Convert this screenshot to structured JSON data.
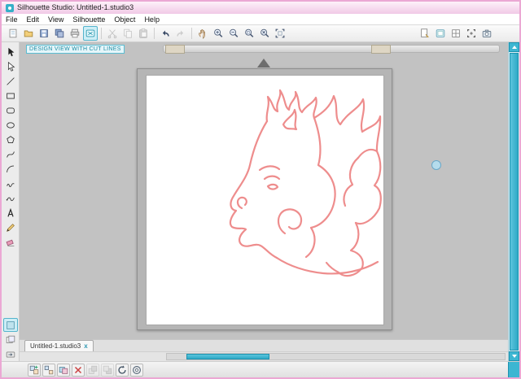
{
  "window": {
    "title": "Silhouette Studio: Untitled-1.studio3"
  },
  "menu": {
    "items": [
      "File",
      "Edit",
      "View",
      "Silhouette",
      "Object",
      "Help"
    ]
  },
  "toolbar": {
    "left": [
      {
        "name": "new-document-button",
        "icon": "doc"
      },
      {
        "name": "open-button",
        "icon": "folder"
      },
      {
        "name": "save-button",
        "icon": "floppy"
      },
      {
        "name": "save-as-button",
        "icon": "floppy2"
      },
      {
        "name": "print-button",
        "icon": "printer"
      },
      {
        "name": "send-to-silhouette-button",
        "icon": "cutter",
        "active": true
      },
      {
        "type": "separator"
      },
      {
        "name": "cut-button",
        "icon": "scissors",
        "disabled": true
      },
      {
        "name": "copy-button",
        "icon": "copy",
        "disabled": true
      },
      {
        "name": "paste-button",
        "icon": "paste",
        "disabled": true
      },
      {
        "type": "separator"
      },
      {
        "name": "undo-button",
        "icon": "undo"
      },
      {
        "name": "redo-button",
        "icon": "redo",
        "disabled": true
      },
      {
        "type": "separator"
      },
      {
        "name": "pan-button",
        "icon": "hand"
      },
      {
        "name": "zoom-in-button",
        "icon": "zoom-in"
      },
      {
        "name": "zoom-out-button",
        "icon": "zoom-out"
      },
      {
        "name": "zoom-selection-button",
        "icon": "zoom-select"
      },
      {
        "name": "drag-zoom-button",
        "icon": "zoom-drag"
      },
      {
        "name": "fit-to-window-button",
        "icon": "fit"
      }
    ],
    "right": [
      {
        "name": "design-page-settings-button",
        "icon": "page-settings"
      },
      {
        "name": "cutting-mat-settings-button",
        "icon": "mat"
      },
      {
        "name": "grid-settings-button",
        "icon": "grid"
      },
      {
        "name": "registration-marks-button",
        "icon": "regmarks"
      },
      {
        "name": "pixscan-button",
        "icon": "camera"
      }
    ]
  },
  "tools": [
    {
      "name": "select-tool",
      "icon": "arrow"
    },
    {
      "name": "edit-points-tool",
      "icon": "arrow-open"
    },
    {
      "name": "line-tool",
      "icon": "line"
    },
    {
      "name": "rectangle-tool",
      "icon": "rect"
    },
    {
      "name": "rounded-rectangle-tool",
      "icon": "rrect"
    },
    {
      "name": "ellipse-tool",
      "icon": "ellipse"
    },
    {
      "name": "polygon-tool",
      "icon": "polygon"
    },
    {
      "name": "curve-tool",
      "icon": "curve"
    },
    {
      "name": "arc-tool",
      "icon": "arc"
    },
    {
      "name": "freehand-tool",
      "icon": "squiggle"
    },
    {
      "name": "smooth-freehand-tool",
      "icon": "squiggle2"
    },
    {
      "name": "text-tool",
      "icon": "textA"
    },
    {
      "name": "draw-notes-tool",
      "icon": "pencil"
    },
    {
      "name": "eraser-tool",
      "icon": "eraser"
    },
    {
      "type": "gap"
    },
    {
      "name": "fill-panel-button",
      "icon": "fill",
      "active": true
    },
    {
      "name": "library-button",
      "icon": "pages"
    },
    {
      "name": "send-panel-button",
      "icon": "send"
    }
  ],
  "canvas": {
    "view_label": "DESIGN VIEW WITH CUT LINES",
    "design": "horse-head-line-art"
  },
  "tabbar": {
    "tab_label": "Untitled-1.studio3",
    "close_glyph": "x"
  },
  "bottom_toolbar": [
    {
      "name": "group-button",
      "icon": "group"
    },
    {
      "name": "ungroup-button",
      "icon": "ungroup"
    },
    {
      "name": "duplicate-button",
      "icon": "duplicate"
    },
    {
      "name": "delete-button",
      "icon": "delete"
    },
    {
      "name": "bring-to-front-button",
      "icon": "forward",
      "disabled": true
    },
    {
      "name": "send-to-back-button",
      "icon": "backward",
      "disabled": true
    },
    {
      "name": "rotate-button",
      "icon": "rotate"
    },
    {
      "name": "weld-button",
      "icon": "weld"
    }
  ],
  "colors": {
    "accent_teal": "#3db6d2",
    "frame_pink": "#eba8d4",
    "cut_line": "#ee8d8d"
  }
}
